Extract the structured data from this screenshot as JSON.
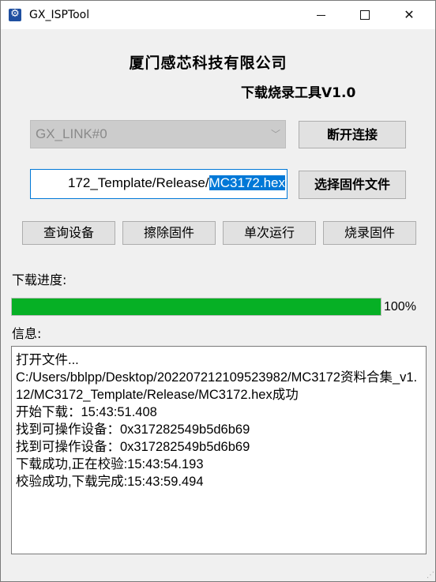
{
  "window": {
    "title": "GX_ISPTool"
  },
  "header": {
    "company": "厦门感芯科技有限公司",
    "tool_title": "下载烧录工具V1.0"
  },
  "connection": {
    "port_value": "GX_LINK#0",
    "disconnect_label": "断开连接"
  },
  "file": {
    "path_prefix": "172_Template/Release/",
    "path_selected": "MC3172.hex",
    "choose_label": "选择固件文件"
  },
  "actions": {
    "query": "查询设备",
    "erase": "擦除固件",
    "run": "单次运行",
    "burn": "烧录固件"
  },
  "progress": {
    "label": "下载进度:",
    "value": 100,
    "text": "100%",
    "bar_color": "#06b025"
  },
  "info": {
    "label": "信息:",
    "lines": [
      "打开文件...",
      "C:/Users/bblpp/Desktop/202207212109523982/MC3172资料合集_v1.12/MC3172_Template/Release/MC3172.hex成功",
      "开始下载：15:43:51.408",
      "找到可操作设备：0x317282549b5d6b69",
      "找到可操作设备：0x317282549b5d6b69",
      "下载成功,正在校验:15:43:54.193",
      "校验成功,下载完成:15:43:59.494"
    ]
  }
}
